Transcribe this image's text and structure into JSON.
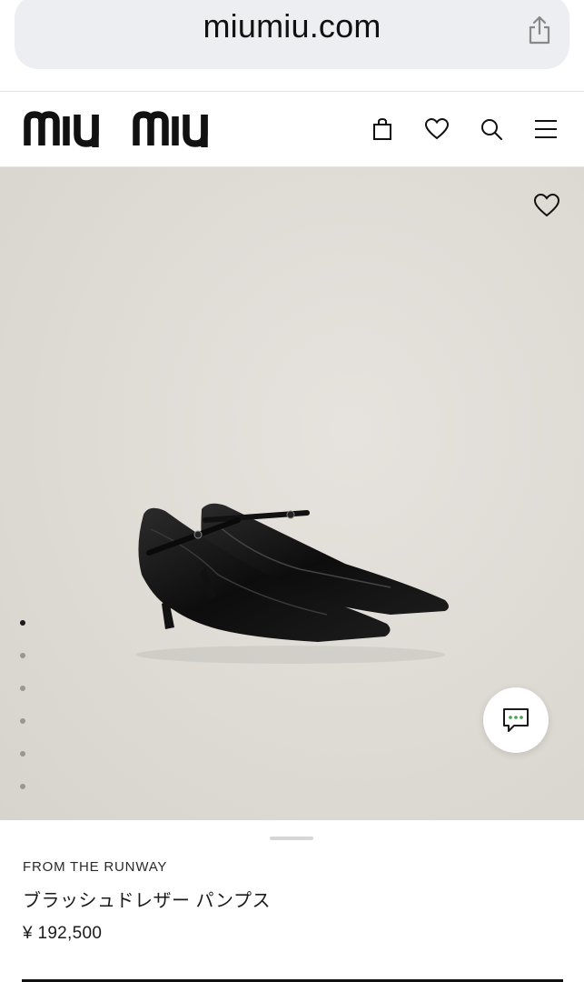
{
  "browser": {
    "url": "miumiu.com"
  },
  "header": {
    "logo_text": "miu miu",
    "icons": [
      "bag-icon",
      "heart-icon",
      "search-icon",
      "menu-icon"
    ]
  },
  "product": {
    "category": "FROM THE RUNWAY",
    "name": "ブラッシュドレザー パンプス",
    "price": "¥ 192,500",
    "image_count": 6,
    "active_image": 1
  },
  "colors": {
    "accent": "#1a1a1a",
    "background": "#dedad4",
    "chat_icon": "#1a1a1a",
    "chat_dots": "#3aa04a"
  }
}
